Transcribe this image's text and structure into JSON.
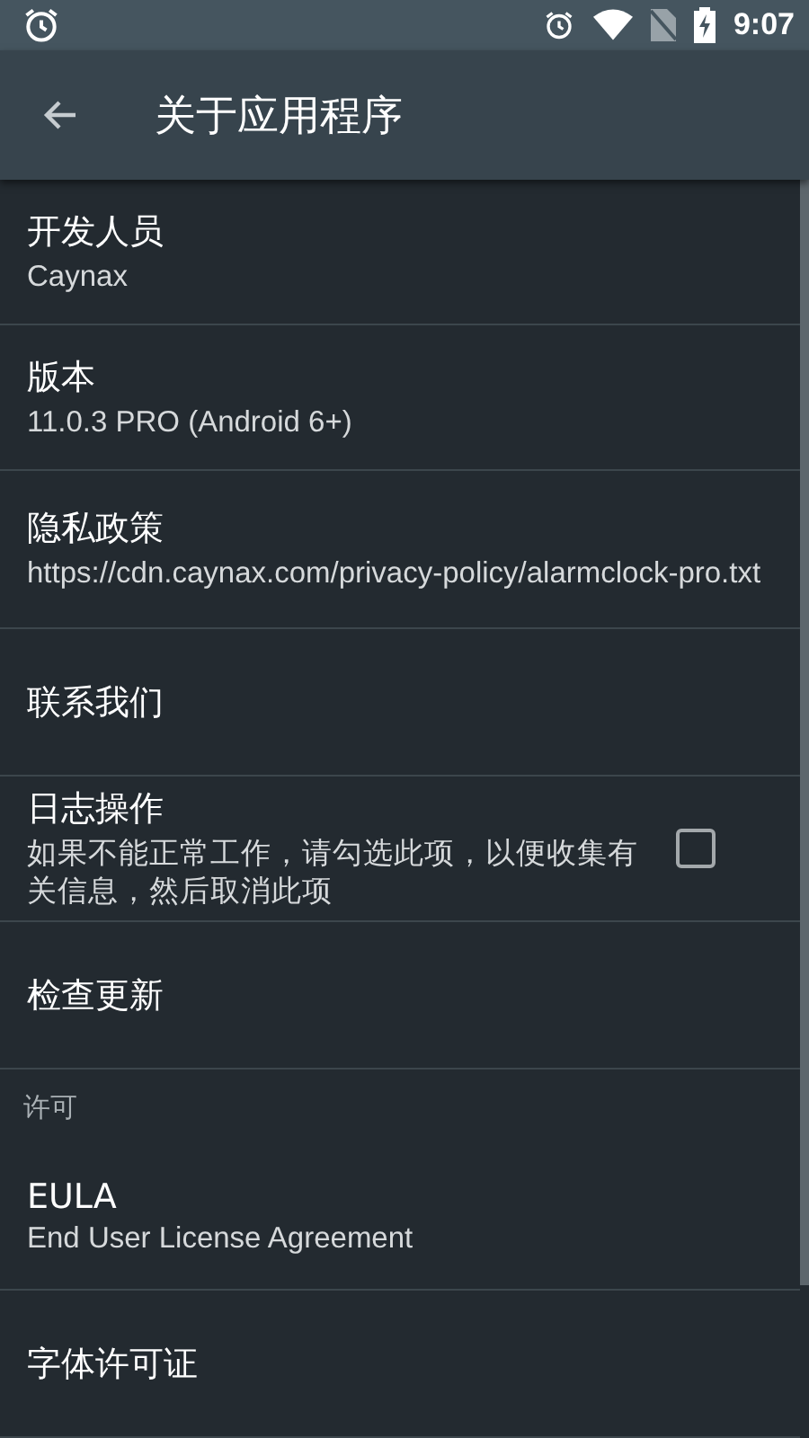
{
  "status_bar": {
    "time": "9:07"
  },
  "toolbar": {
    "title": "关于应用程序"
  },
  "items": [
    {
      "kind": "item",
      "title": "开发人员",
      "summary": "Caynax"
    },
    {
      "kind": "item",
      "title": "版本",
      "summary": "11.0.3 PRO (Android 6+)"
    },
    {
      "kind": "item",
      "title": "隐私政策",
      "summary": "https://cdn.caynax.com/privacy-policy/alarmclock-pro.txt"
    },
    {
      "kind": "item",
      "title": "联系我们"
    },
    {
      "kind": "checkbox",
      "title": "日志操作",
      "summary": "如果不能正常工作，请勾选此项，以便收集有关信息，然后取消此项",
      "checked": false
    },
    {
      "kind": "item",
      "title": "检查更新"
    },
    {
      "kind": "header",
      "title": "许可"
    },
    {
      "kind": "item",
      "title": "EULA",
      "summary": "End User License Agreement"
    },
    {
      "kind": "item",
      "title": "字体许可证"
    }
  ]
}
